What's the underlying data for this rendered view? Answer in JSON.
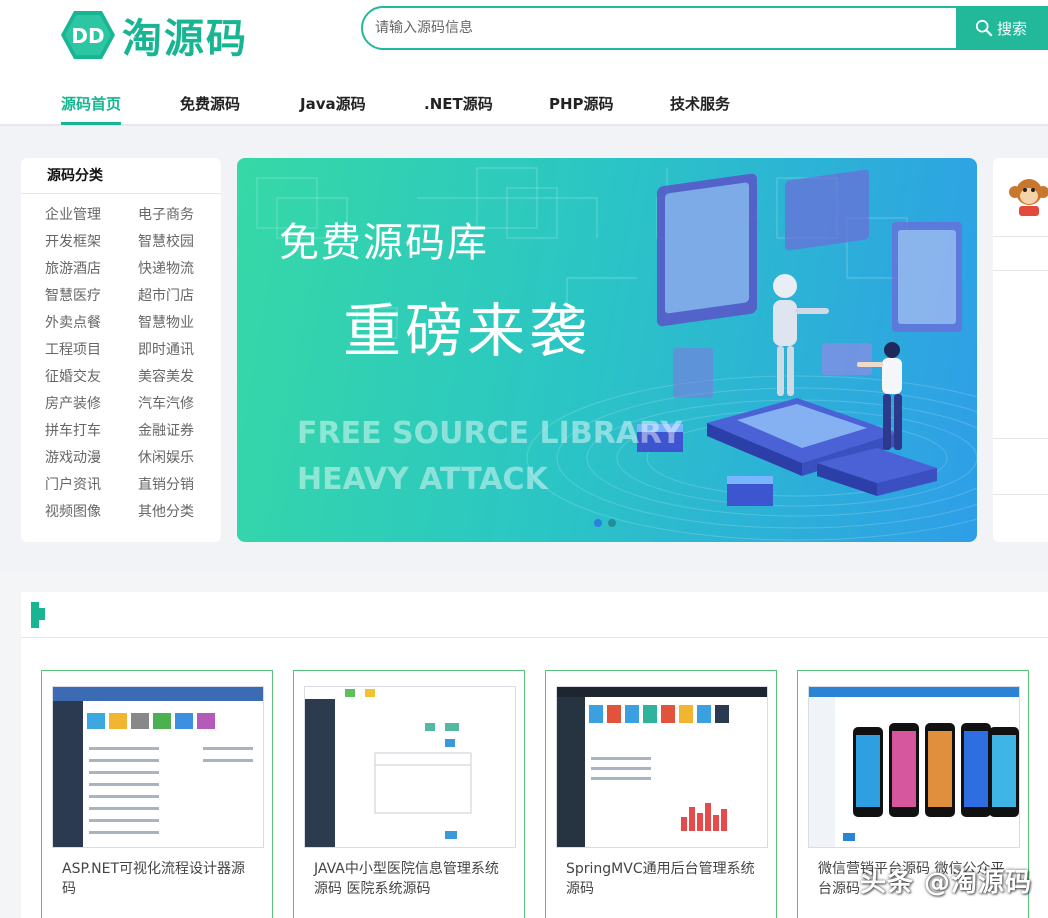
{
  "header": {
    "logo_text": "淘源码",
    "logo_mark_text": "DD",
    "search_placeholder": "请输入源码信息",
    "search_button": "搜索",
    "accent_color": "#17b592"
  },
  "nav": {
    "items": [
      {
        "label": "源码首页",
        "active": true
      },
      {
        "label": "免费源码",
        "active": false
      },
      {
        "label": "Java源码",
        "active": false
      },
      {
        "label": ".NET源码",
        "active": false
      },
      {
        "label": "PHP源码",
        "active": false
      },
      {
        "label": "技术服务",
        "active": false
      }
    ]
  },
  "categories": {
    "title": "源码分类",
    "items": [
      "企业管理",
      "电子商务",
      "开发框架",
      "智慧校园",
      "旅游酒店",
      "快递物流",
      "智慧医疗",
      "超市门店",
      "外卖点餐",
      "智慧物业",
      "工程项目",
      "即时通讯",
      "征婚交友",
      "美容美发",
      "房产装修",
      "汽车汽修",
      "拼车打车",
      "金融证券",
      "游戏动漫",
      "休闲娱乐",
      "门户资讯",
      "直销分销",
      "视频图像",
      "其他分类"
    ]
  },
  "banner": {
    "title_small": "免费源码库",
    "title_large": "重磅来袭",
    "en_line1": "FREE SOURCE LIBRARY",
    "en_line2": "HEAVY ATTACK",
    "slide_count": 2,
    "active_slide": 1
  },
  "products": [
    {
      "title": "ASP.NET可视化流程设计器源码"
    },
    {
      "title": "JAVA中小型医院信息管理系统源码 医院系统源码"
    },
    {
      "title": "SpringMVC通用后台管理系统源码"
    },
    {
      "title": "微信营销平台源码 微信公众平台源码"
    }
  ],
  "watermark": "头条 @淘源码"
}
